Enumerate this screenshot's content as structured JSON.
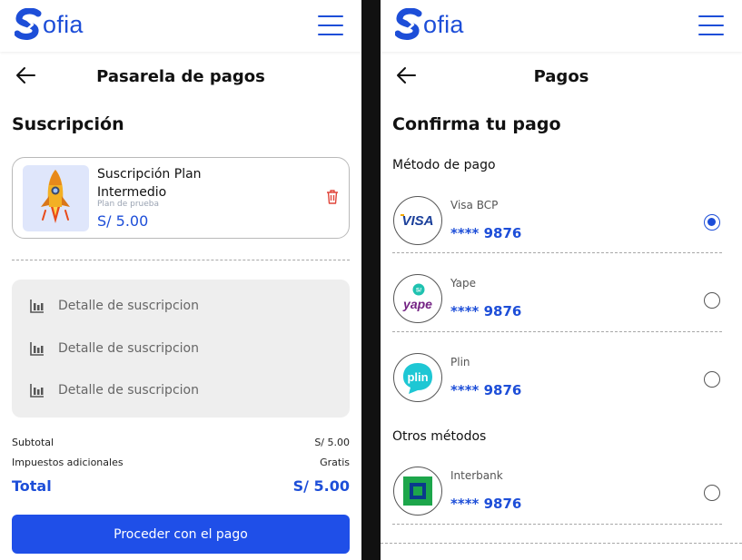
{
  "colors": {
    "brand": "#1d4ed8",
    "button": "#1f4fe8",
    "muted": "#9aa3b2"
  },
  "left": {
    "logo_text": "ofia",
    "header_title": "Pasarela de pagos",
    "section_title": "Suscripción",
    "card": {
      "name": "Suscripción Plan Intermedio",
      "subtitle": "Plan de prueba",
      "price": "S/ 5.00"
    },
    "details": [
      {
        "label": "Detalle de suscripcion",
        "icon": "bar-chart-icon"
      },
      {
        "label": "Detalle de suscripcion",
        "icon": "bar-chart-icon"
      },
      {
        "label": "Detalle de suscripcion",
        "icon": "bar-chart-icon"
      }
    ],
    "summary": {
      "subtotal_label": "Subtotal",
      "subtotal_value": "S/ 5.00",
      "taxes_label": "Impuestos  adicionales",
      "taxes_value": "Gratis",
      "total_label": "Total",
      "total_value": "S/ 5.00"
    },
    "button_label": "Proceder con el pago"
  },
  "right": {
    "logo_text": "ofia",
    "header_title": "Pagos",
    "section_title": "Confirma tu pago",
    "methods_label": "Método de pago",
    "other_label": "Otros  métodos",
    "methods": [
      {
        "name": "Visa BCP",
        "number": "**** 9876",
        "selected": true,
        "logo_text": "VISA"
      },
      {
        "name": "Yape",
        "number": "**** 9876",
        "selected": false,
        "logo_text": "yape",
        "badge": "S/"
      },
      {
        "name": "Plin",
        "number": "**** 9876",
        "selected": false,
        "logo_text": "plin"
      }
    ],
    "other_methods": [
      {
        "name": "Interbank",
        "number": "**** 9876",
        "selected": false
      }
    ]
  }
}
